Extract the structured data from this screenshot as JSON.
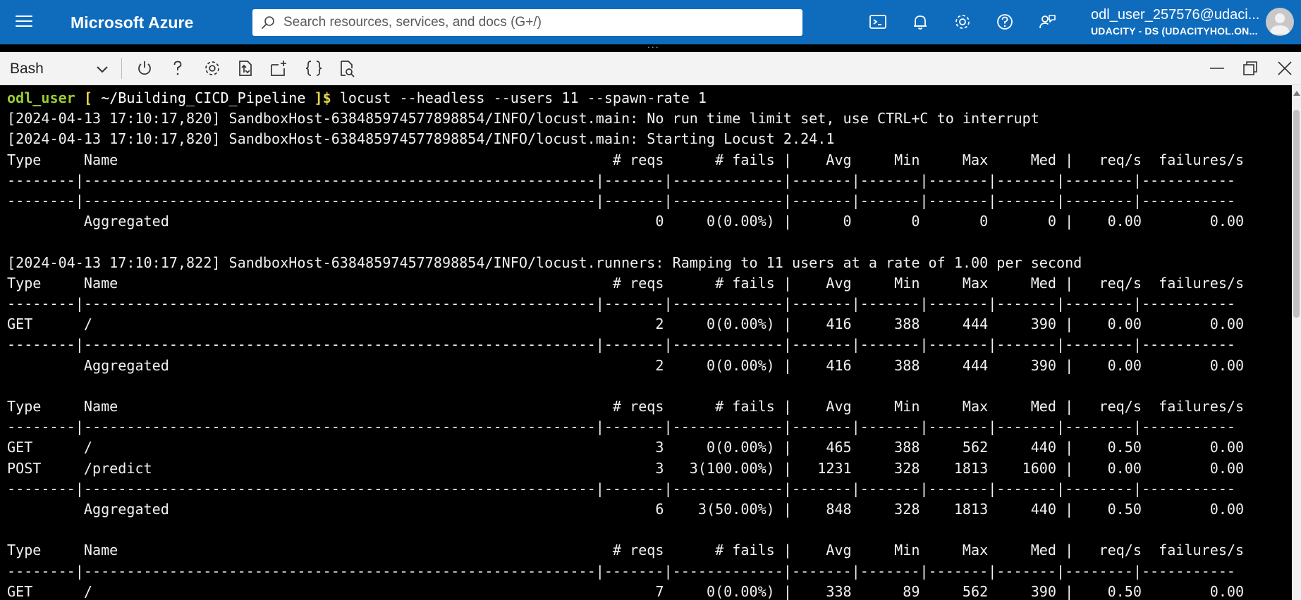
{
  "header": {
    "brand": "Microsoft Azure",
    "search_placeholder": "Search resources, services, and docs (G+/)",
    "icons": [
      "cloud-shell-icon",
      "notifications-icon",
      "settings-icon",
      "help-icon",
      "feedback-icon"
    ],
    "account_name": "odl_user_257576@udaci...",
    "account_org": "UDACITY - DS (UDACITYHOL.ON...",
    "grip": "..."
  },
  "toolbar": {
    "shell": "Bash",
    "icons": [
      "power-icon",
      "help-icon",
      "settings-icon",
      "upload-download-icon",
      "new-session-icon",
      "braces-icon",
      "web-preview-icon"
    ],
    "window_controls": [
      "minimize-icon",
      "restore-icon",
      "close-icon"
    ]
  },
  "terminal": {
    "prompt_user": "odl_user",
    "prompt_open": " [ ",
    "prompt_dir": "~/Building_CICD_Pipeline",
    "prompt_close": " ]$ ",
    "command": "locust --headless --users 11 --spawn-rate 1",
    "output": "[2024-04-13 17:10:17,820] SandboxHost-638485974577898854/INFO/locust.main: No run time limit set, use CTRL+C to interrupt\n[2024-04-13 17:10:17,820] SandboxHost-638485974577898854/INFO/locust.main: Starting Locust 2.24.1\nType     Name                                                          # reqs      # fails |    Avg     Min     Max     Med |   req/s  failures/s\n--------|------------------------------------------------------------|-------|-------------|-------|-------|-------|-------|--------|-----------\n--------|------------------------------------------------------------|-------|-------------|-------|-------|-------|-------|--------|-----------\n         Aggregated                                                         0     0(0.00%) |      0       0       0       0 |    0.00        0.00\n\n[2024-04-13 17:10:17,822] SandboxHost-638485974577898854/INFO/locust.runners: Ramping to 11 users at a rate of 1.00 per second\nType     Name                                                          # reqs      # fails |    Avg     Min     Max     Med |   req/s  failures/s\n--------|------------------------------------------------------------|-------|-------------|-------|-------|-------|-------|--------|-----------\nGET      /                                                                  2     0(0.00%) |    416     388     444     390 |    0.00        0.00\n--------|------------------------------------------------------------|-------|-------------|-------|-------|-------|-------|--------|-----------\n         Aggregated                                                         2     0(0.00%) |    416     388     444     390 |    0.00        0.00\n\nType     Name                                                          # reqs      # fails |    Avg     Min     Max     Med |   req/s  failures/s\n--------|------------------------------------------------------------|-------|-------------|-------|-------|-------|-------|--------|-----------\nGET      /                                                                  3     0(0.00%) |    465     388     562     440 |    0.50        0.00\nPOST     /predict                                                           3   3(100.00%) |   1231     328    1813    1600 |    0.00        0.00\n--------|------------------------------------------------------------|-------|-------------|-------|-------|-------|-------|--------|-----------\n         Aggregated                                                         6    3(50.00%) |    848     328    1813     440 |    0.50        0.00\n\nType     Name                                                          # reqs      # fails |    Avg     Min     Max     Med |   req/s  failures/s\n--------|------------------------------------------------------------|-------|-------------|-------|-------|-------|-------|--------|-----------\nGET      /                                                                  7     0(0.00%) |    338      89     562     390 |    0.50        0.00"
  },
  "colors": {
    "azure_blue": "#0f6cbd",
    "prompt_user": "#9ace33",
    "prompt_bracket": "#e3d84a",
    "terminal_bg": "#000000",
    "terminal_fg": "#f0f0f0"
  }
}
